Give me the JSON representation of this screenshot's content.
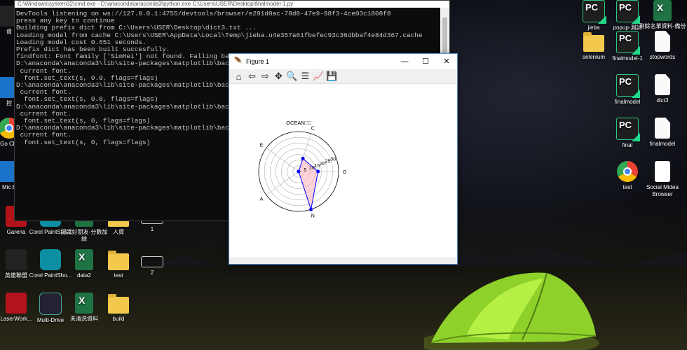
{
  "console": {
    "title": "C:\\Windows\\system32\\cmd.exe - D:\\anaconda\\anaconda3\\python.exe   C:\\Users\\USER\\Desktop\\finalmodel-1.py",
    "lines": [
      "DevTools listening on ws://127.0.0.1:4755/devtools/browser/e291d0ac-78d8-47e9-98f3-4ce03c1808f8",
      "press any key to continue",
      "Building prefix dict from C:\\Users\\USER\\Desktop\\dict3.txt ...",
      "Loading model from cache C:\\Users\\USER\\AppData\\Local\\Temp\\jieba.u4e357a61fbefec93c36dbbaf4e84d367.cache",
      "Loading model cost 0.651 seconds.",
      "Prefix dict has been built succesfully.",
      "findfont: Font family ['SimHei'] not found. Falling back to",
      "D:\\anaconda\\anaconda3\\lib\\site-packages\\matplotlib\\backends\\",
      " current font.",
      "  font.set_text(s, 0.0, flags=flags)",
      "D:\\anaconda\\anaconda3\\lib\\site-packages\\matplotlib\\backends\\",
      " current font.",
      "  font.set_text(s, 0.0, flags=flags)",
      "D:\\anaconda\\anaconda3\\lib\\site-packages\\matplotlib\\backends\\",
      " current font.",
      "  font.set_text(s, 0, flags=flags)",
      "D:\\anaconda\\anaconda3\\lib\\site-packages\\matplotlib\\backends\\",
      " current font.",
      "  font.set_text(s, 0, flags=flags)"
    ]
  },
  "figure": {
    "title": "Figure 1",
    "toolbar": [
      "home-icon",
      "back-icon",
      "forward-icon",
      "pan-icon",
      "zoom-icon",
      "configure-icon",
      "edit-curves-icon",
      "save-icon"
    ]
  },
  "chart_data": {
    "type": "radar",
    "title": "OCEAN□□",
    "categories": [
      "O",
      "C",
      "E",
      "A",
      "N"
    ],
    "values": [
      17,
      12,
      0,
      0,
      35
    ],
    "rticks": [
      "5",
      "10",
      "15",
      "20",
      "25",
      "30"
    ],
    "rlim": [
      0,
      35
    ],
    "line_color": "#0000ff",
    "fill_color": "#ffb6c1"
  },
  "desktop_icons": [
    {
      "label": "jieba",
      "icon": "pc-icon",
      "kind": "pc"
    },
    {
      "label": "popup-測試",
      "icon": "pc-icon",
      "kind": "pc"
    },
    {
      "label": "剩餘名單資料-備份",
      "icon": "excel-icon",
      "kind": "excel"
    },
    {
      "label": "selenium",
      "icon": "folder-icon",
      "kind": "folder"
    },
    {
      "label": "finalmodel-1",
      "icon": "pc-icon",
      "kind": "pc"
    },
    {
      "label": "stopwords",
      "icon": "document-icon",
      "kind": "doc"
    },
    {
      "label": "finalmodel",
      "icon": "pc-icon",
      "kind": "pc"
    },
    {
      "label": "dict3",
      "icon": "document-icon",
      "kind": "doc"
    },
    {
      "label": "final",
      "icon": "pc-icon",
      "kind": "pc"
    },
    {
      "label": "finalmodel",
      "icon": "document-icon",
      "kind": "doc"
    },
    {
      "label": "test",
      "icon": "chrome-icon",
      "kind": "chrome"
    },
    {
      "label": "Social Midea Browser",
      "icon": "app-icon",
      "kind": "app"
    },
    {
      "label": "資",
      "icon": "app-icon",
      "kind": "dark"
    },
    {
      "label": "控",
      "icon": "app-icon",
      "kind": "blue"
    },
    {
      "label": "Go Chr",
      "icon": "chrome-icon",
      "kind": "chrome"
    },
    {
      "label": "Mic E",
      "icon": "app-icon",
      "kind": "blue"
    },
    {
      "label": "Garena",
      "icon": "garena-icon",
      "kind": "red"
    },
    {
      "label": "Corel PaintSho...",
      "icon": "corel-icon",
      "kind": "teal"
    },
    {
      "label": "認識好朋友-分數加總",
      "icon": "excel-icon",
      "kind": "excel"
    },
    {
      "label": "人資",
      "icon": "folder-icon",
      "kind": "folder"
    },
    {
      "label": "1",
      "icon": "app-icon",
      "kind": "black"
    },
    {
      "label": "英雄聯盟",
      "icon": "lol-icon",
      "kind": "dark"
    },
    {
      "label": "Corel PaintSho...",
      "icon": "corel-icon",
      "kind": "teal"
    },
    {
      "label": "data2",
      "icon": "excel-icon",
      "kind": "excel"
    },
    {
      "label": "test",
      "icon": "folder-icon",
      "kind": "folder"
    },
    {
      "label": "2",
      "icon": "app-icon",
      "kind": "black"
    },
    {
      "label": "LaserWork...",
      "icon": "laserwork-icon",
      "kind": "red"
    },
    {
      "label": "Multi-Drive",
      "icon": "nox-icon",
      "kind": "nox"
    },
    {
      "label": "未清洗資料",
      "icon": "excel-icon",
      "kind": "excel"
    },
    {
      "label": "build",
      "icon": "folder-icon",
      "kind": "folder"
    }
  ]
}
